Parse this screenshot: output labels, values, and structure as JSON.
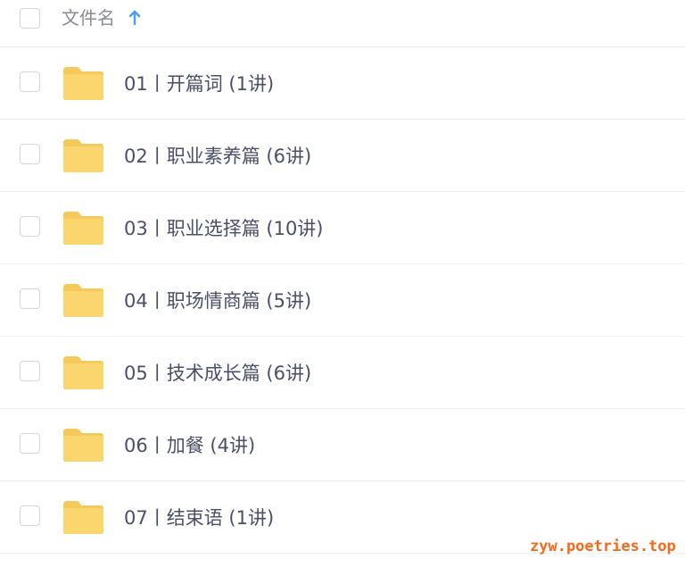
{
  "header": {
    "column_label": "文件名",
    "sort_icon": "arrow-up-icon",
    "sort_color": "#4a9cf5"
  },
  "files": [
    {
      "name": "01丨开篇词 (1讲)",
      "icon": "folder-icon"
    },
    {
      "name": "02丨职业素养篇 (6讲)",
      "icon": "folder-icon"
    },
    {
      "name": "03丨职业选择篇 (10讲)",
      "icon": "folder-icon"
    },
    {
      "name": "04丨职场情商篇 (5讲)",
      "icon": "folder-icon"
    },
    {
      "name": "05丨技术成长篇 (6讲)",
      "icon": "folder-icon"
    },
    {
      "name": "06丨加餐 (4讲)",
      "icon": "folder-icon"
    },
    {
      "name": "07丨结束语 (1讲)",
      "icon": "folder-icon"
    }
  ],
  "watermark": "zyw.poetries.top",
  "colors": {
    "folder": "#fbd66f",
    "folder_tab": "#f5c95a",
    "text": "#4a5066",
    "watermark": "#f36b1c"
  }
}
